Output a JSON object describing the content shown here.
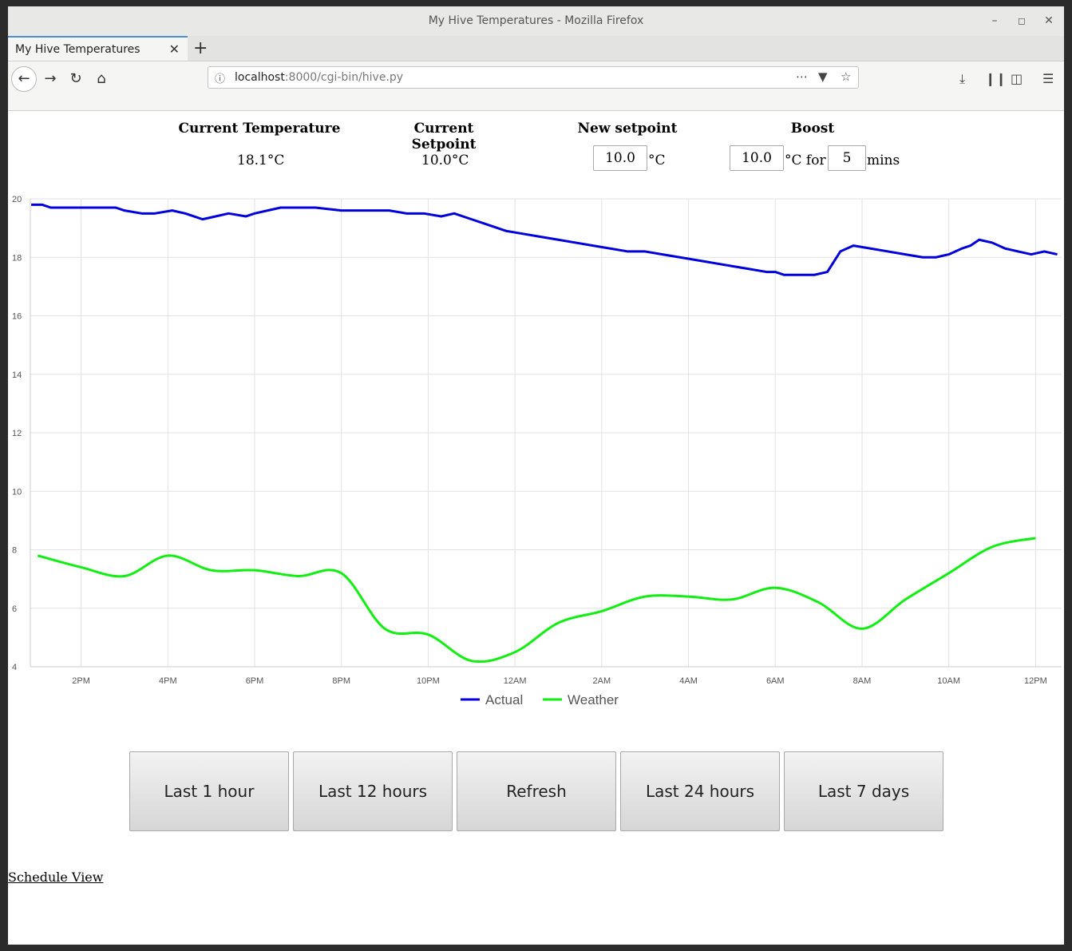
{
  "window": {
    "title": "My Hive Temperatures - Mozilla Firefox"
  },
  "tab": {
    "label": "My Hive Temperatures"
  },
  "urlbar": {
    "host": "localhost",
    "rest": ":8000/cgi-bin/hive.py"
  },
  "header": {
    "current_temperature_label": "Current Temperature",
    "current_temperature_value": "18.1°C",
    "current_setpoint_label": "Current Setpoint",
    "current_setpoint_value": "10.0°C",
    "new_setpoint_label": "New setpoint",
    "new_setpoint_value": "10.0",
    "new_setpoint_unit": "°C",
    "boost_label": "Boost",
    "boost_temp_value": "10.0",
    "boost_unit_for": "°C for",
    "boost_minutes_value": "5",
    "boost_minutes_unit": "mins"
  },
  "range_buttons": [
    "Last 1 hour",
    "Last 12 hours",
    "Refresh",
    "Last 24 hours",
    "Last 7 days"
  ],
  "schedule_link": "Schedule View",
  "chart_data": {
    "type": "line",
    "ylim": [
      4,
      20
    ],
    "yticks": [
      "4",
      "6",
      "8",
      "10",
      "12",
      "14",
      "16",
      "18",
      "20"
    ],
    "xticks": [
      {
        "label": "2PM",
        "t": 14
      },
      {
        "label": "4PM",
        "t": 16
      },
      {
        "label": "6PM",
        "t": 18
      },
      {
        "label": "8PM",
        "t": 20
      },
      {
        "label": "10PM",
        "t": 22
      },
      {
        "label": "12AM",
        "t": 24
      },
      {
        "label": "2AM",
        "t": 26
      },
      {
        "label": "4AM",
        "t": 28
      },
      {
        "label": "6AM",
        "t": 30
      },
      {
        "label": "8AM",
        "t": 32
      },
      {
        "label": "10AM",
        "t": 34
      },
      {
        "label": "12PM",
        "t": 36
      }
    ],
    "xlim": [
      12.83,
      36.6
    ],
    "grid": true,
    "legend_position": "bottom",
    "series": [
      {
        "name": "Actual",
        "color": "#0000dd",
        "x": [
          12.85,
          13.1,
          13.3,
          14.0,
          14.6,
          14.8,
          15.0,
          15.4,
          15.7,
          16.1,
          16.4,
          16.6,
          16.8,
          17.1,
          17.4,
          17.8,
          18.0,
          18.3,
          18.6,
          18.9,
          19.4,
          20.0,
          20.6,
          21.1,
          21.5,
          21.9,
          22.3,
          22.6,
          23.0,
          23.4,
          23.8,
          24.2,
          24.6,
          25.0,
          25.4,
          25.8,
          26.2,
          26.6,
          27.0,
          27.4,
          27.8,
          28.2,
          28.6,
          29.0,
          29.4,
          29.8,
          30.0,
          30.2,
          30.6,
          30.9,
          31.2,
          31.5,
          31.8,
          32.2,
          32.6,
          33.0,
          33.4,
          33.7,
          34.0,
          34.3,
          34.5,
          34.7,
          35.0,
          35.3,
          35.6,
          35.9,
          36.2,
          36.5
        ],
        "values": [
          19.8,
          19.8,
          19.7,
          19.7,
          19.7,
          19.7,
          19.6,
          19.5,
          19.5,
          19.6,
          19.5,
          19.4,
          19.3,
          19.4,
          19.5,
          19.4,
          19.5,
          19.6,
          19.7,
          19.7,
          19.7,
          19.6,
          19.6,
          19.6,
          19.5,
          19.5,
          19.4,
          19.5,
          19.3,
          19.1,
          18.9,
          18.8,
          18.7,
          18.6,
          18.5,
          18.4,
          18.3,
          18.2,
          18.2,
          18.1,
          18.0,
          17.9,
          17.8,
          17.7,
          17.6,
          17.5,
          17.5,
          17.4,
          17.4,
          17.4,
          17.5,
          18.2,
          18.4,
          18.3,
          18.2,
          18.1,
          18.0,
          18.0,
          18.1,
          18.3,
          18.4,
          18.6,
          18.5,
          18.3,
          18.2,
          18.1,
          18.2,
          18.1
        ]
      },
      {
        "name": "Weather",
        "color": "#11ee11",
        "x": [
          13.0,
          14.0,
          15.0,
          16.0,
          17.0,
          18.0,
          19.0,
          20.0,
          21.0,
          22.0,
          23.0,
          24.0,
          25.0,
          26.0,
          27.0,
          28.0,
          29.0,
          30.0,
          31.0,
          32.0,
          33.0,
          34.0,
          35.0,
          36.0
        ],
        "values": [
          7.8,
          7.4,
          7.1,
          7.8,
          7.3,
          7.3,
          7.1,
          7.2,
          5.3,
          5.1,
          4.2,
          4.5,
          5.5,
          5.9,
          6.4,
          6.4,
          6.3,
          6.7,
          6.2,
          5.3,
          6.3,
          7.2,
          8.1,
          8.4
        ]
      }
    ]
  }
}
